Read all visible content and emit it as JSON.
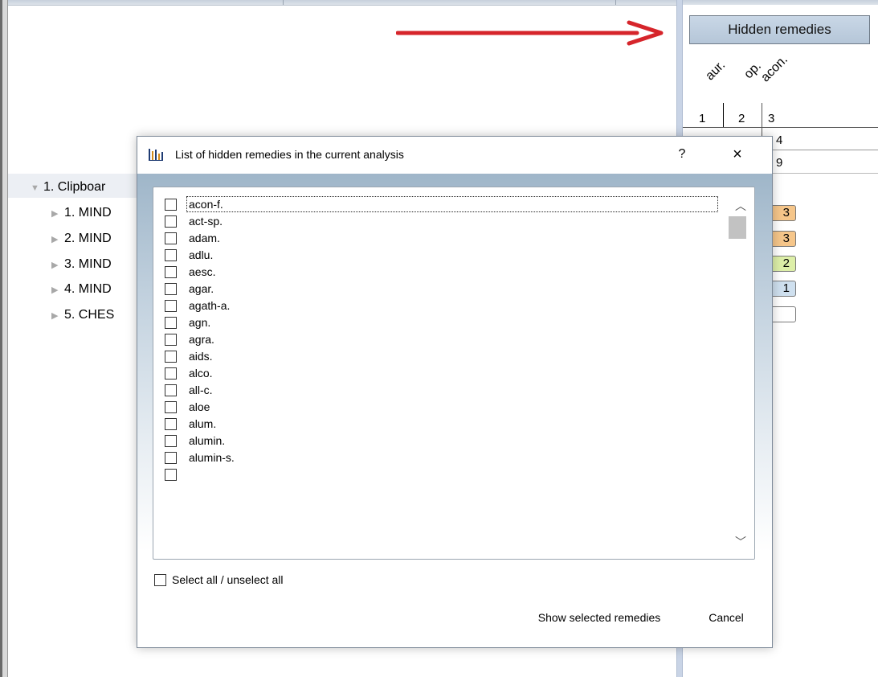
{
  "background": {
    "hidden_remedies_button": "Hidden remedies",
    "remedy_headers": [
      "aur.",
      "op.",
      "acon."
    ],
    "grid_numbers": {
      "row1": [
        "1",
        "2",
        "3"
      ],
      "row2": "4",
      "row3": "9"
    },
    "score_badges": [
      {
        "value": "3",
        "color": "#f6c68a"
      },
      {
        "value": "3",
        "color": "#f6c68a"
      },
      {
        "value": "2",
        "color": "#ddefa8"
      },
      {
        "value": "1",
        "color": "#cfe0ef"
      },
      {
        "value": "",
        "color": "#ffffff"
      }
    ],
    "tree": {
      "root": "1. Clipboar",
      "children": [
        "1. MIND",
        "2. MIND",
        "3. MIND",
        "4. MIND",
        "5. CHES"
      ]
    },
    "arrow_color": "#d6252b"
  },
  "dialog": {
    "title": "List of hidden remedies in the current analysis",
    "help_label": "?",
    "close_label": "×",
    "remedies": [
      "acon-f.",
      "act-sp.",
      "adam.",
      "adlu.",
      "aesc.",
      "agar.",
      "agath-a.",
      "agn.",
      "agra.",
      "aids.",
      "alco.",
      "all-c.",
      "aloe",
      "alum.",
      "alumin.",
      "alumin-s."
    ],
    "select_all_label": "Select all / unselect all",
    "show_selected_label": "Show selected remedies",
    "cancel_label": "Cancel"
  }
}
